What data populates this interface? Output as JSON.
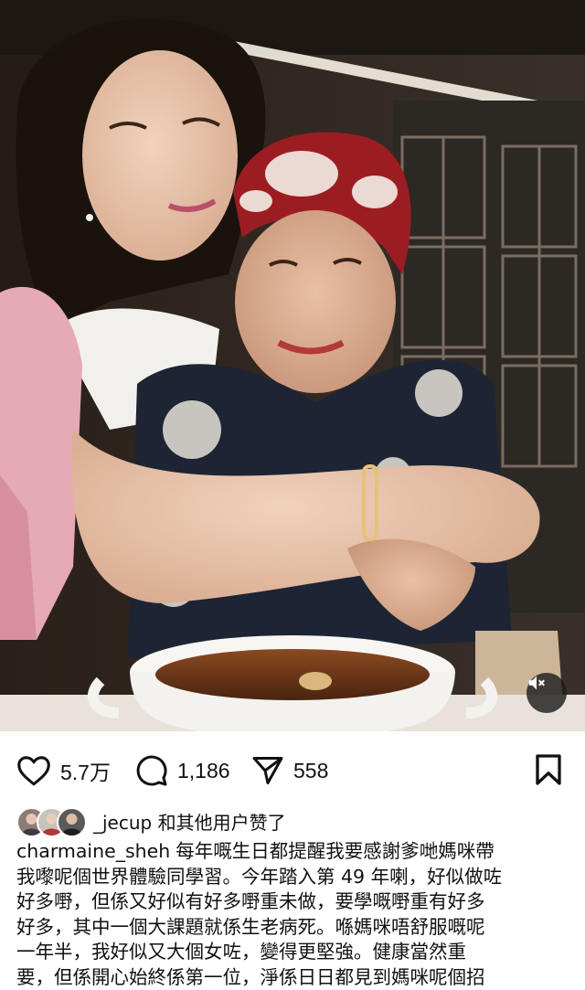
{
  "post": {
    "photo": {
      "alt": "Two women hugging at a dinner table with a bowl of soup",
      "mute_icon": "speaker-muted-icon"
    },
    "actions": {
      "like_icon": "heart-outline-icon",
      "like_count": "5.7万",
      "comment_icon": "comment-bubble-icon",
      "comment_count": "1,186",
      "share_icon": "paper-plane-icon",
      "share_count": "558",
      "save_icon": "bookmark-outline-icon"
    },
    "likes": {
      "liker": "_jecup",
      "suffix": " 和其他用户赞了"
    },
    "caption": {
      "username": "charmaine_sheh",
      "lines": [
        "每年嘅生日都提醒我要感謝爹哋媽咪帶",
        "我嚟呢個世界體驗同學習。今年踏入第 49 年喇，好似做咗",
        "好多嘢，但係又好似有好多嘢重未做，要學嘅嘢重有好多",
        "好多，其中一個大課題就係生老病死。喺媽咪唔舒服嘅呢",
        "一年半，我好似又大個女咗，變得更堅強。健康當然重",
        "要，但係開心始終係第一位，淨係日日都見到媽咪呢個招"
      ]
    }
  },
  "colors": {
    "text": "#111111",
    "background": "#ffffff"
  }
}
